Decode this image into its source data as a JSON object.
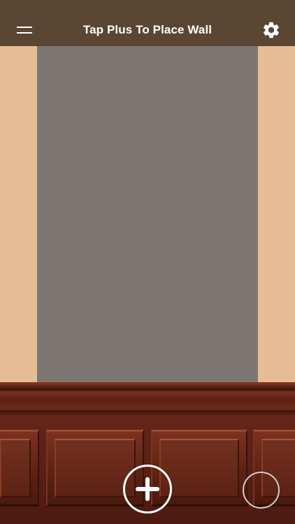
{
  "header": {
    "title": "Tap Plus To Place Wall",
    "background_color": "#5a4632",
    "menu_icon": "hamburger-menu-icon",
    "settings_icon": "gear-icon"
  },
  "scene": {
    "room_wall_color": "#e6bd95",
    "placed_wall_color": "#7e7771",
    "wainscoting": "dark cherry wood paneling"
  },
  "controls": {
    "add_icon": "plus-icon",
    "capture_icon": "circle-shutter-icon"
  }
}
